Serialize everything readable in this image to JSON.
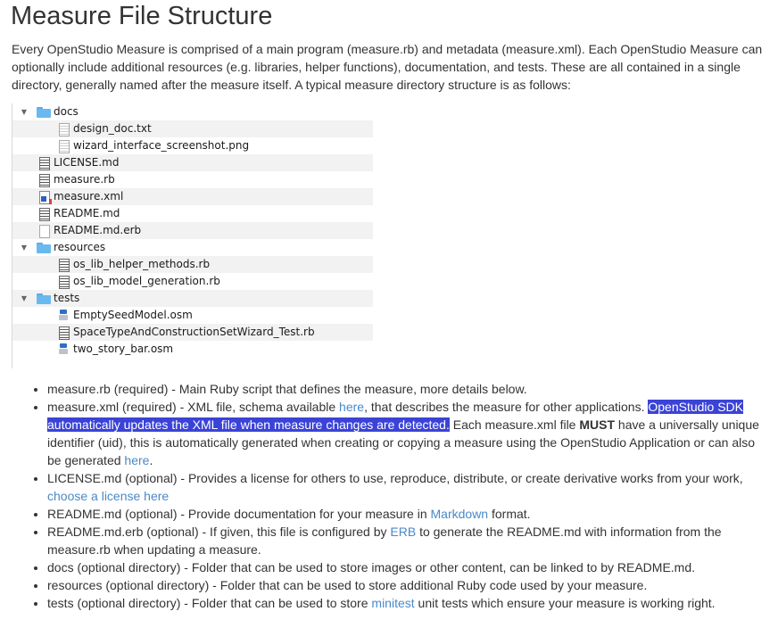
{
  "title": "Measure File Structure",
  "intro": "Every OpenStudio Measure is comprised of a main program (measure.rb) and metadata (measure.xml). Each OpenStudio Measure can optionally include additional resources (e.g. libraries, helper functions), documentation, and tests. These are all contained in a single directory, generally named after the measure itself. A typical measure directory structure is as follows:",
  "tree": [
    {
      "name": "docs",
      "icon": "folder-icon"
    },
    {
      "name": "design_doc.txt",
      "icon": "text-file-icon"
    },
    {
      "name": "wizard_interface_screenshot.png",
      "icon": "image-file-icon"
    },
    {
      "name": "LICENSE.md",
      "icon": "file-icon"
    },
    {
      "name": "measure.rb",
      "icon": "file-icon"
    },
    {
      "name": "measure.xml",
      "icon": "xml-file-icon"
    },
    {
      "name": "README.md",
      "icon": "file-icon"
    },
    {
      "name": "README.md.erb",
      "icon": "blank-file-icon"
    },
    {
      "name": "resources",
      "icon": "folder-icon"
    },
    {
      "name": "os_lib_helper_methods.rb",
      "icon": "file-icon"
    },
    {
      "name": "os_lib_model_generation.rb",
      "icon": "file-icon"
    },
    {
      "name": "tests",
      "icon": "folder-icon"
    },
    {
      "name": "EmptySeedModel.osm",
      "icon": "osm-file-icon"
    },
    {
      "name": "SpaceTypeAndConstructionSetWizard_Test.rb",
      "icon": "file-icon"
    },
    {
      "name": "two_story_bar.osm",
      "icon": "osm-file-icon"
    }
  ],
  "items": {
    "rb": "measure.rb (required) - Main Ruby script that defines the measure, more details below.",
    "xml_a": "measure.xml (required) - XML file, schema available ",
    "xml_link1": "here",
    "xml_b": ", that describes the measure for other applications. ",
    "xml_hl": "OpenStudio SDK automatically updates the XML file when measure changes are detected.",
    "xml_c": " Each measure.xml file ",
    "xml_must": "MUST",
    "xml_d": " have a universally unique identifier (uid), this is automatically generated when creating or copying a measure using the OpenStudio Application or can also be generated ",
    "xml_link2": "here",
    "xml_e": ".",
    "lic_a": "LICENSE.md (optional) - Provides a license for others to use, reproduce, distribute, or create derivative works from your work, ",
    "lic_link": "choose a license here",
    "readme_a": "README.md (optional) - Provide documentation for your measure in ",
    "readme_link": "Markdown",
    "readme_b": " format.",
    "erb_a": "README.md.erb (optional) - If given, this file is configured by ",
    "erb_link": "ERB",
    "erb_b": " to generate the README.md with information from the measure.rb when updating a measure.",
    "docs": "docs (optional directory) - Folder that can be used to store images or other content, can be linked to by README.md.",
    "resources": "resources (optional directory) - Folder that can be used to store additional Ruby code used by your measure.",
    "tests_a": "tests (optional directory) - Folder that can be used to store ",
    "tests_link": "minitest",
    "tests_b": " unit tests which ensure your measure is working right."
  },
  "colors": {
    "link": "#4a89c8",
    "highlight": "#3b43d6",
    "folder": "#69b9ee"
  }
}
